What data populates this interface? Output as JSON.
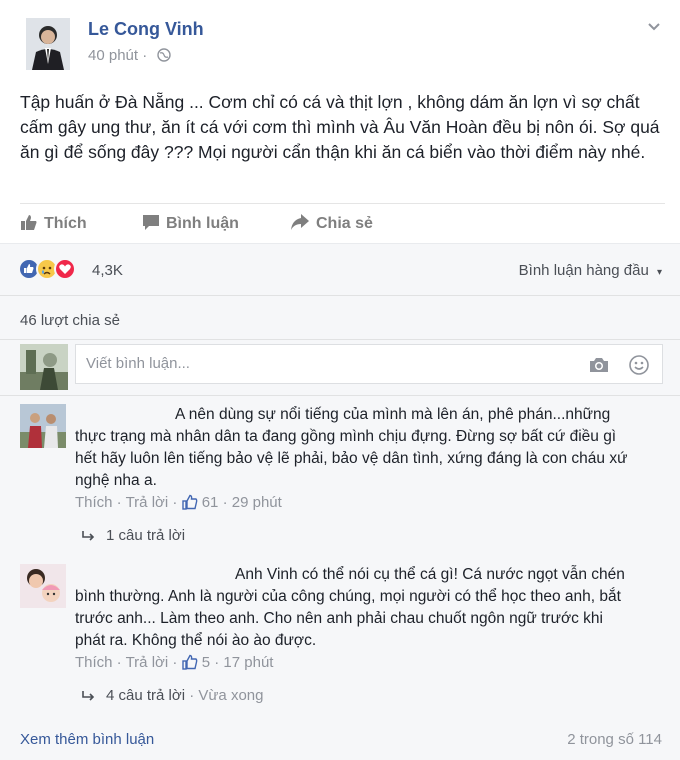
{
  "post": {
    "author": "Le Cong Vinh",
    "time": "40 phút",
    "body": "Tập huấn ở Đà Nẵng ... Cơm chỉ có cá và thịt lợn , không dám ăn lợn vì sợ chất cấm gây ung thư, ăn ít cá với cơm thì mình và Âu Văn Hoàn đều bị nôn ói. Sợ quá ăn gì để sống đây ??? Mọi người cẩn thận khi ăn cá biển vào thời điểm này nhé."
  },
  "actions": {
    "like": "Thích",
    "comment": "Bình luận",
    "share": "Chia sẻ"
  },
  "reactions": {
    "count": "4,3K",
    "sort_label": "Bình luận hàng đầu"
  },
  "shares": {
    "label": "46 lượt chia sẻ"
  },
  "composer": {
    "placeholder": "Viết bình luận..."
  },
  "comments": [
    {
      "text": "A nên dùng sự nổi tiếng của mình mà lên án, phê phán...những thực trạng mà nhân dân ta đang gồng mình chịu đựng. Đừng sợ bất cứ điều gì hết hãy luôn lên tiếng bảo vệ lẽ phải, bảo vệ dân tình, xứng đáng là con cháu xứ nghệ nha a.",
      "like_label": "Thích",
      "reply_label": "Trả lời",
      "like_count": "61",
      "time": "29 phút",
      "replies": "1 câu trả lời"
    },
    {
      "text": "Anh Vinh có thể nói cụ thể cá gì! Cá nước ngọt vẫn chén bình thường. Anh là người của công chúng, mọi người có thể học theo anh, bắt trước anh... Làm theo anh. Cho nên anh phải chau chuốt ngôn ngữ trước khi phát ra. Không thể nói ào ào được.",
      "like_label": "Thích",
      "reply_label": "Trả lời",
      "like_count": "5",
      "time": "17 phút",
      "replies": "4 câu trả lời",
      "replies_time": "Vừa xong"
    }
  ],
  "footer": {
    "more": "Xem thêm bình luận",
    "count": "2 trong số 114"
  },
  "colors": {
    "link": "#365899",
    "muted": "#90949c",
    "panel": "#f6f7f9",
    "like_blue": "#4267b2",
    "love_red": "#f0284a",
    "haha_yellow": "#f7c84a"
  }
}
